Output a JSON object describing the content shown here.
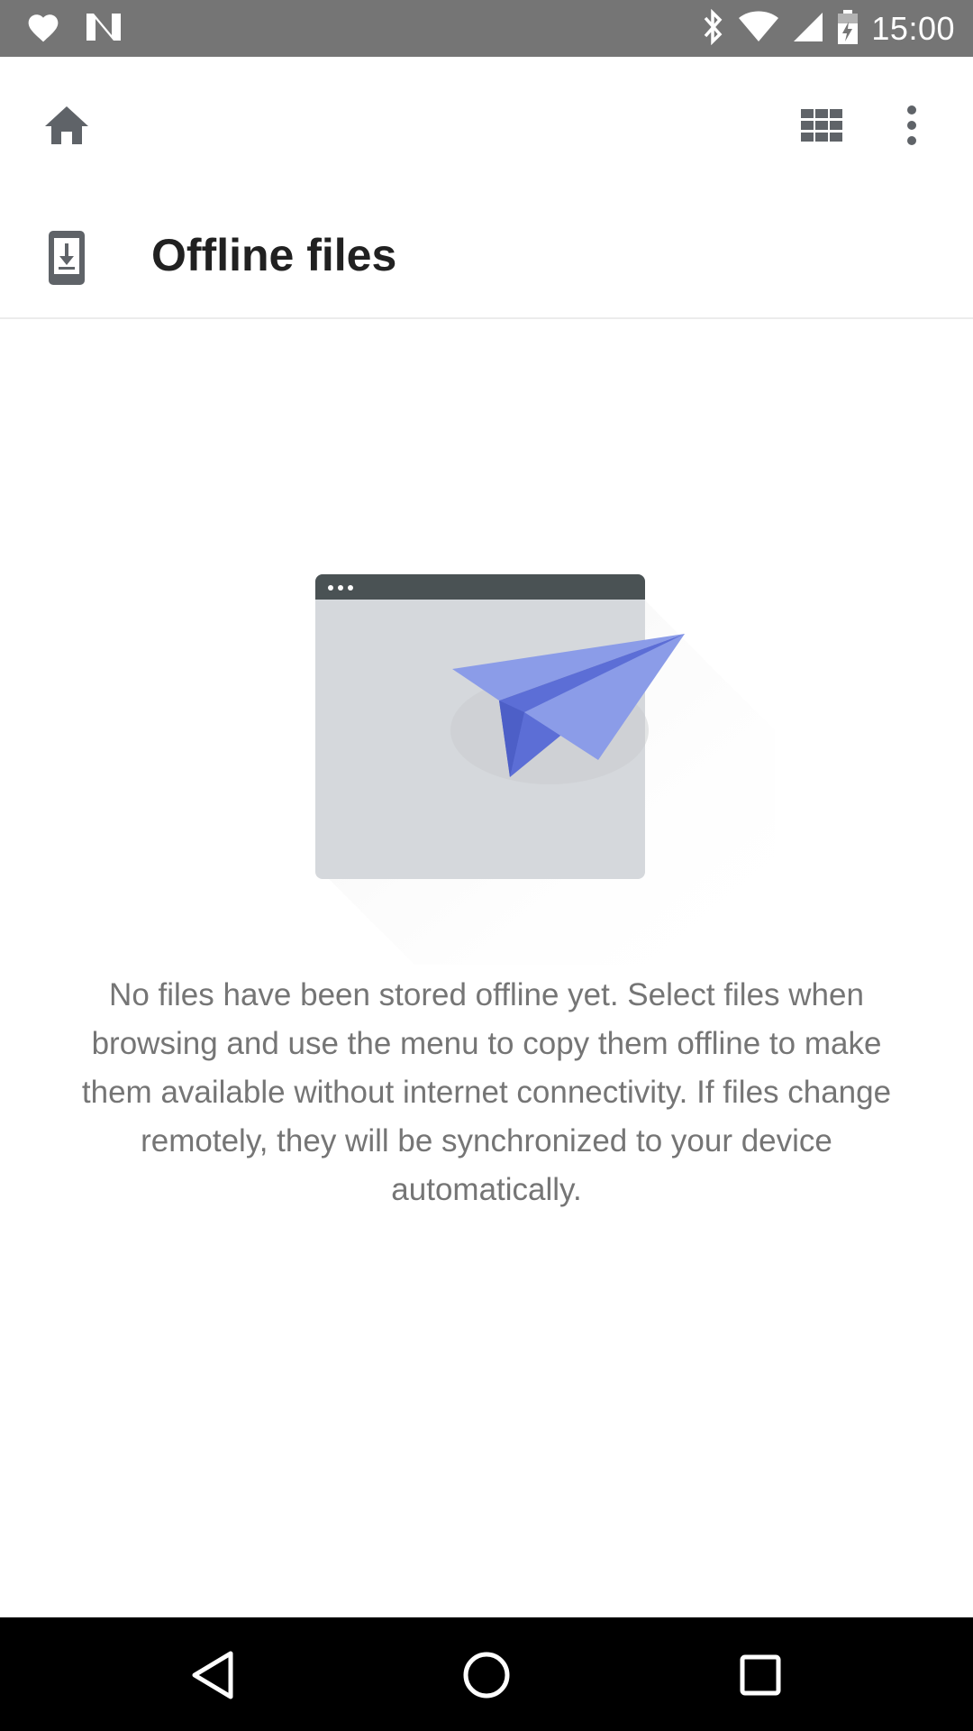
{
  "status_bar": {
    "time": "15:00",
    "left_icons": [
      "heart-icon",
      "n-notification-icon"
    ],
    "right_icons": [
      "bluetooth-icon",
      "wifi-icon",
      "cell-signal-icon",
      "battery-charging-icon"
    ],
    "background": "#757575"
  },
  "app_bar": {
    "home_icon": "home-icon",
    "grid_icon": "grid-view-icon",
    "more_icon": "more-vertical-icon"
  },
  "header": {
    "title": "Offline files",
    "icon": "offline-download-icon"
  },
  "empty_state": {
    "illustration": "paper-plane-window-illustration",
    "message": "No files have been stored offline yet. Select files when browsing and use the menu to copy them offline to make them available without internet connectivity. If files change remotely, they will be synchronized to your device automatically."
  },
  "nav_bar": {
    "back_icon": "back-triangle-icon",
    "home_icon": "home-circle-icon",
    "recents_icon": "recents-square-icon"
  },
  "colors": {
    "accent": "#7B8EE6",
    "icon_grey": "#5f6368",
    "title_text": "#212121",
    "body_text": "#757575"
  }
}
